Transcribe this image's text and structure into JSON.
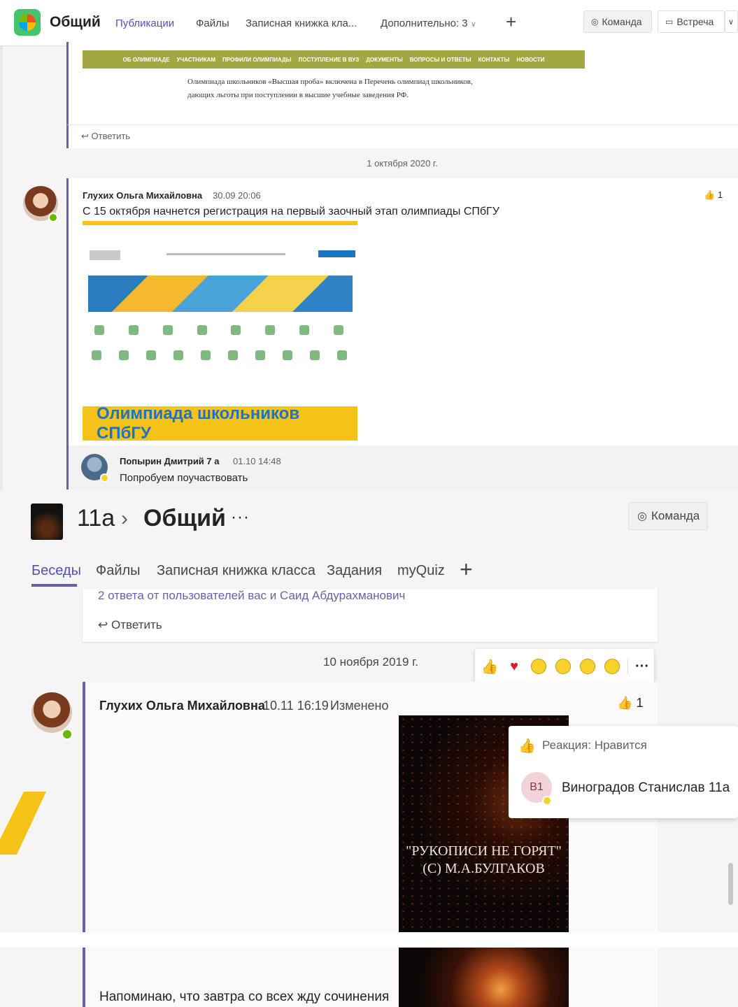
{
  "panel1": {
    "header": {
      "title": "Общий",
      "tabs": [
        {
          "label": "Публикации",
          "active": true
        },
        {
          "label": "Файлы"
        },
        {
          "label": "Записная книжка кла..."
        },
        {
          "label": "Дополнительно: 3"
        }
      ],
      "team_button": "Команда",
      "meet_button": "Встреча"
    },
    "post1": {
      "nav_items": [
        "ОБ ОЛИМПИАДЕ",
        "УЧАСТНИКАМ",
        "ПРОФИЛИ ОЛИМПИАДЫ",
        "ПОСТУПЛЕНИЕ В ВУЗ",
        "ДОКУМЕНТЫ",
        "ВОПРОСЫ И ОТВЕТЫ",
        "КОНТАКТЫ",
        "НОВОСТИ"
      ],
      "text": "Олимпиада школьников «Высшая проба» включена в Перечень олимпиад школьников, дающих льготы при поступлении в высшие учебные заведения РФ.",
      "reply_label": "Ответить"
    },
    "date_divider": "1 октября 2020 г.",
    "post2": {
      "author": "Глухих Ольга Михайловна",
      "time": "30.09 20:06",
      "text": "С 15 октября начнется регистрация на первый заочный этап олимпиады СПбГУ",
      "likes": "1",
      "banner_label": "Олимпиада школьников СПбГУ"
    },
    "reply": {
      "author": "Попырин Дмитрий 7 а",
      "time": "01.10 14:48",
      "text": "Попробуем поучаствовать"
    }
  },
  "panel2": {
    "breadcrumb": {
      "team": "11а",
      "channel": "Общий",
      "more": "···"
    },
    "team_button": "Команда",
    "tabs": [
      {
        "label": "Беседы",
        "active": true
      },
      {
        "label": "Файлы"
      },
      {
        "label": "Записная книжка класса"
      },
      {
        "label": "Задания"
      },
      {
        "label": "myQuiz"
      }
    ],
    "thread": {
      "replies_text": "2 ответа от пользователей вас и Саид Абдурахманович",
      "reply_label": "Ответить"
    },
    "date_divider": "10 ноября 2019 г.",
    "post": {
      "author": "Глухих Ольга Михайловна",
      "time": "10.11 16:19",
      "edited": "Изменено",
      "likes": "1",
      "image_text_line1": "\"РУКОПИСИ НЕ ГОРЯТ\"",
      "image_text_line2": "(С) М.А.БУЛГАКОВ"
    },
    "reaction_popup": {
      "title": "Реакция: Нравится",
      "user_initials": "В1",
      "user_name": "Виноградов Станислав 11а"
    },
    "post2": {
      "text": "Напоминаю, что завтра со всех жду сочинения"
    }
  }
}
